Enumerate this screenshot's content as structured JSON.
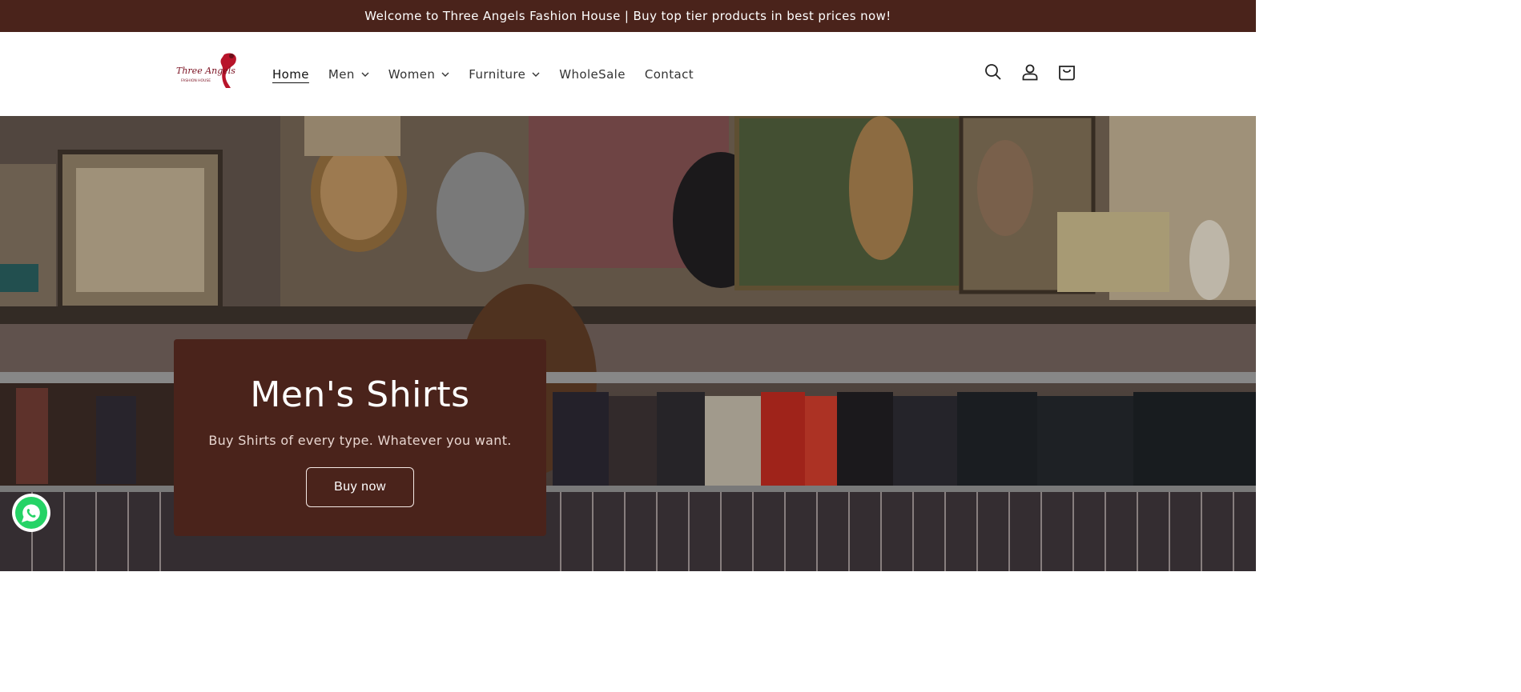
{
  "announcement": {
    "text": "Welcome to Three Angels Fashion House | Buy top tier products in best prices now!"
  },
  "header": {
    "logo": {
      "line1": "Three Angels",
      "line2": "FASHION HOUSE"
    },
    "nav": [
      {
        "label": "Home",
        "active": true,
        "dropdown": false
      },
      {
        "label": "Men",
        "active": false,
        "dropdown": true
      },
      {
        "label": "Women",
        "active": false,
        "dropdown": true
      },
      {
        "label": "Furniture",
        "active": false,
        "dropdown": true
      },
      {
        "label": "WholeSale",
        "active": false,
        "dropdown": false
      },
      {
        "label": "Contact",
        "active": false,
        "dropdown": false
      }
    ],
    "icons": [
      "search-icon",
      "account-icon",
      "cart-icon"
    ]
  },
  "hero": {
    "title": "Men's Shirts",
    "subtitle": "Buy Shirts of every type. Whatever you want.",
    "button_label": "Buy now"
  },
  "floating": {
    "icon": "whatsapp-icon"
  },
  "colors": {
    "brand": "#4a231b",
    "header_bg": "#ffffff",
    "text_dark": "#333333"
  }
}
